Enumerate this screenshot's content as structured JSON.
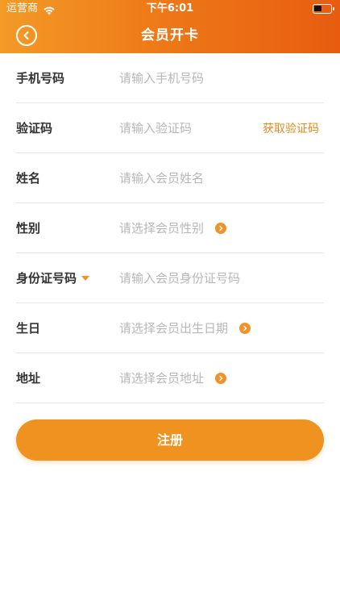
{
  "status_bar": {
    "carrier": "运营商",
    "time": "下午6:01",
    "battery_level": 0.45
  },
  "nav": {
    "title": "会员开卡"
  },
  "form": {
    "phone": {
      "label": "手机号码",
      "placeholder": "请输入手机号码"
    },
    "code": {
      "label": "验证码",
      "placeholder": "请输入验证码",
      "action": "获取验证码"
    },
    "name": {
      "label": "姓名",
      "placeholder": "请输入会员姓名"
    },
    "gender": {
      "label": "性别",
      "placeholder": "请选择会员性别"
    },
    "id_number": {
      "label": "身份证号码",
      "placeholder": "请输入会员身份证号码"
    },
    "birthday": {
      "label": "生日",
      "placeholder": "请选择会员出生日期"
    },
    "address": {
      "label": "地址",
      "placeholder": "请选择会员地址"
    }
  },
  "submit_label": "注册",
  "colors": {
    "header_start": "#f39a27",
    "header_end": "#e85c10",
    "accent": "#f0921f",
    "link": "#e8891c",
    "placeholder": "#b7b7b7",
    "divider": "#e8e8e8"
  },
  "icons": {
    "back": "back-arrow-circle-icon",
    "select_arrow": "chevron-right-circle-icon",
    "dropdown": "caret-down-icon",
    "wifi": "wifi-icon",
    "battery": "battery-icon"
  }
}
